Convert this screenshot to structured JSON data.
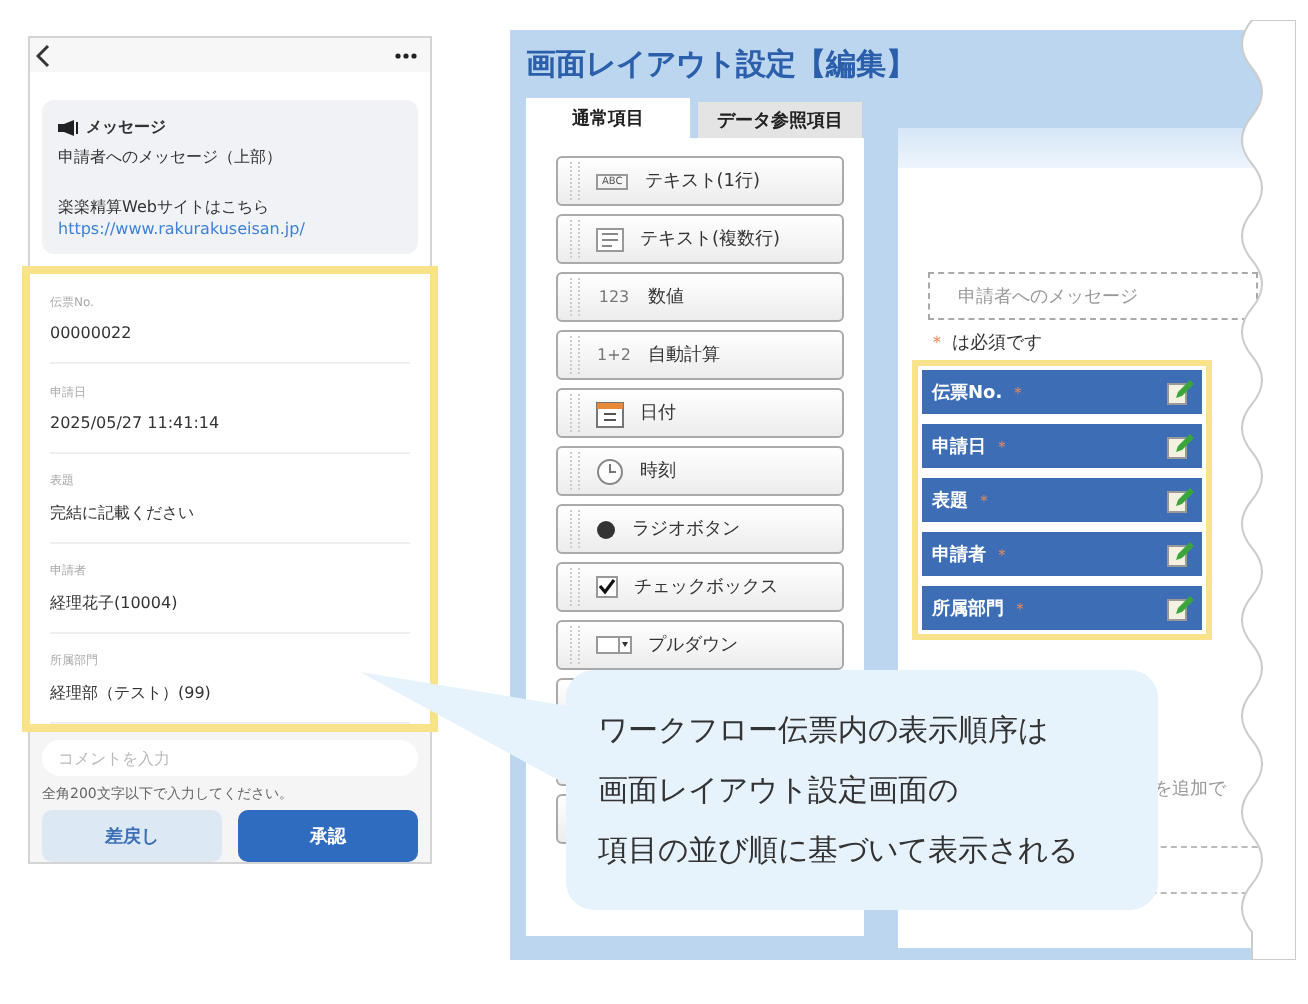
{
  "phone": {
    "message_card": {
      "title": "メッセージ",
      "body": "申請者へのメッセージ（上部）",
      "site_text": "楽楽精算Webサイトはこちら",
      "link": "https://www.rakurakuseisan.jp/"
    },
    "fields_highlighted": true,
    "fields": [
      {
        "label": "伝票No.",
        "value": "00000022"
      },
      {
        "label": "申請日",
        "value": "2025/05/27 11:41:14"
      },
      {
        "label": "表題",
        "value": "完結に記載ください"
      },
      {
        "label": "申請者",
        "value": "経理花子(10004)"
      },
      {
        "label": "所属部門",
        "value": "経理部（テスト）(99)"
      }
    ],
    "comment": {
      "placeholder": "コメントを入力",
      "note": "全角200文字以下で入力してください。"
    },
    "buttons": [
      {
        "label": "差戻し",
        "kind": "secondary"
      },
      {
        "label": "承認",
        "kind": "primary"
      }
    ]
  },
  "layout_editor": {
    "title": "画面レイアウト設定【編集】",
    "tabs": [
      {
        "label": "通常項目",
        "selected": true
      },
      {
        "label": "データ参照項目",
        "selected": false
      }
    ],
    "palette": [
      {
        "kind": "abc",
        "glyph": "ABC",
        "label": "テキスト(1行)"
      },
      {
        "kind": "lines",
        "label": "テキスト(複数行)"
      },
      {
        "kind": "num",
        "glyph": "123",
        "label": "数値"
      },
      {
        "kind": "num",
        "glyph": "1+2",
        "label": "自動計算"
      },
      {
        "kind": "calendar",
        "label": "日付"
      },
      {
        "kind": "clock",
        "label": "時刻"
      },
      {
        "kind": "radio",
        "label": "ラジオボタン"
      },
      {
        "kind": "checkbox",
        "label": "チェックボックス"
      },
      {
        "kind": "dropdown",
        "label": "プルダウン"
      },
      {
        "kind": "blank"
      },
      {
        "kind": "blank"
      },
      {
        "kind": "blank"
      }
    ],
    "message_box": "申請者へのメッセージ",
    "required_legend": {
      "mark": "＊",
      "text": "は必須です"
    },
    "items_highlighted": true,
    "items": [
      {
        "label": "伝票No.",
        "mark": "＊"
      },
      {
        "label": "申請日",
        "mark": "＊"
      },
      {
        "label": "表題",
        "mark": "＊"
      },
      {
        "label": "申請者",
        "mark": "＊"
      },
      {
        "label": "所属部門",
        "mark": "＊"
      }
    ],
    "hint_fragment": "を追加で"
  },
  "callout": [
    "ワークフロー伝票内の表示順序は",
    "画面レイアウト設定画面の",
    "項目の並び順に基づいて表示される"
  ]
}
